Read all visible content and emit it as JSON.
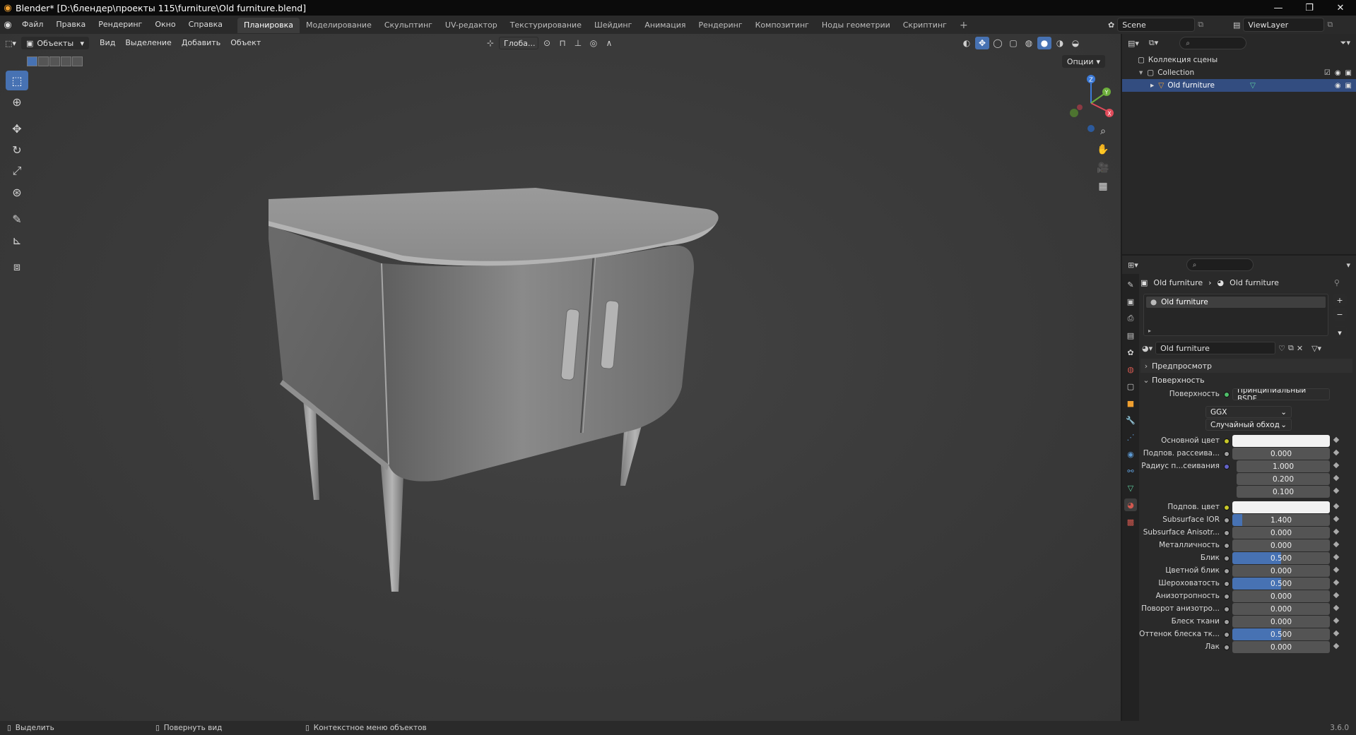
{
  "window": {
    "title": "Blender* [D:\\блендер\\проекты 115\\furniture\\Old furniture.blend]",
    "controls": [
      "—",
      "❐",
      "✕"
    ]
  },
  "menu": [
    "Файл",
    "Правка",
    "Рендеринг",
    "Окно",
    "Справка"
  ],
  "workspaces": {
    "tabs": [
      "Планировка",
      "Моделирование",
      "Скульптинг",
      "UV-редактор",
      "Текстурирование",
      "Шейдинг",
      "Анимация",
      "Рендеринг",
      "Композитинг",
      "Ноды геометрии",
      "Скриптинг"
    ],
    "active": "Планировка",
    "add": "+"
  },
  "scene": {
    "name": "Scene",
    "view_layer": "ViewLayer"
  },
  "viewport": {
    "mode": "Объекты",
    "menus": [
      "Вид",
      "Выделение",
      "Добавить",
      "Объект"
    ],
    "orientation": "Глоба...",
    "options": "Опции",
    "gizmo": {
      "x": "X",
      "y": "Y",
      "z": "Z"
    }
  },
  "outliner": {
    "search_placeholder": "",
    "root": "Коллекция сцены",
    "collection": "Collection",
    "object": "Old furniture"
  },
  "properties": {
    "breadcrumb_object": "Old furniture",
    "breadcrumb_material": "Old furniture",
    "slot_name": "Old furniture",
    "material_name": "Old furniture",
    "sections": {
      "preview": "Предпросмотр",
      "surface": "Поверхность"
    },
    "surface_label": "Поверхность",
    "surface_shader": "Принципиальный BSDF",
    "distribution": "GGX",
    "subsurface_method": "Случайный обход",
    "rows": [
      {
        "label": "Основной цвет",
        "value": "",
        "type": "color",
        "dot": "yellow"
      },
      {
        "label": "Подпов. рассеива...",
        "value": "0.000",
        "type": "num",
        "dot": "gray",
        "fill": 0
      },
      {
        "label": "Радиус п...сеивания",
        "value": "1.000",
        "type": "vec",
        "dot": "purple",
        "fill": 0
      },
      {
        "label": "",
        "value": "0.200",
        "type": "vec",
        "dot": "",
        "fill": 0
      },
      {
        "label": "",
        "value": "0.100",
        "type": "vec",
        "dot": "",
        "fill": 0
      },
      {
        "label": "Подпов. цвет",
        "value": "",
        "type": "color",
        "dot": "yellow"
      },
      {
        "label": "Subsurface IOR",
        "value": "1.400",
        "type": "num",
        "dot": "gray",
        "fill": 0.1
      },
      {
        "label": "Subsurface Anisotr...",
        "value": "0.000",
        "type": "num",
        "dot": "gray",
        "fill": 0
      },
      {
        "label": "Металличность",
        "value": "0.000",
        "type": "num",
        "dot": "gray",
        "fill": 0
      },
      {
        "label": "Блик",
        "value": "0.500",
        "type": "num",
        "dot": "gray",
        "fill": 0.5
      },
      {
        "label": "Цветной блик",
        "value": "0.000",
        "type": "num",
        "dot": "gray",
        "fill": 0
      },
      {
        "label": "Шероховатость",
        "value": "0.500",
        "type": "num",
        "dot": "gray",
        "fill": 0.5
      },
      {
        "label": "Анизотропность",
        "value": "0.000",
        "type": "num",
        "dot": "gray",
        "fill": 0
      },
      {
        "label": "Поворот анизотро...",
        "value": "0.000",
        "type": "num",
        "dot": "gray",
        "fill": 0
      },
      {
        "label": "Блеск ткани",
        "value": "0.000",
        "type": "num",
        "dot": "gray",
        "fill": 0
      },
      {
        "label": "Оттенок блеска тк...",
        "value": "0.500",
        "type": "num",
        "dot": "gray",
        "fill": 0.5
      },
      {
        "label": "Лак",
        "value": "0.000",
        "type": "num",
        "dot": "gray",
        "fill": 0
      }
    ]
  },
  "statusbar": {
    "select": "Выделить",
    "rotate": "Повернуть вид",
    "context": "Контекстное меню объектов",
    "version": "3.6.0"
  },
  "colors": {
    "accent": "#4772b3",
    "selected_row": "#334d80",
    "viewport_bg": "#3d3d3d",
    "panel_bg": "#2a2a2a"
  }
}
